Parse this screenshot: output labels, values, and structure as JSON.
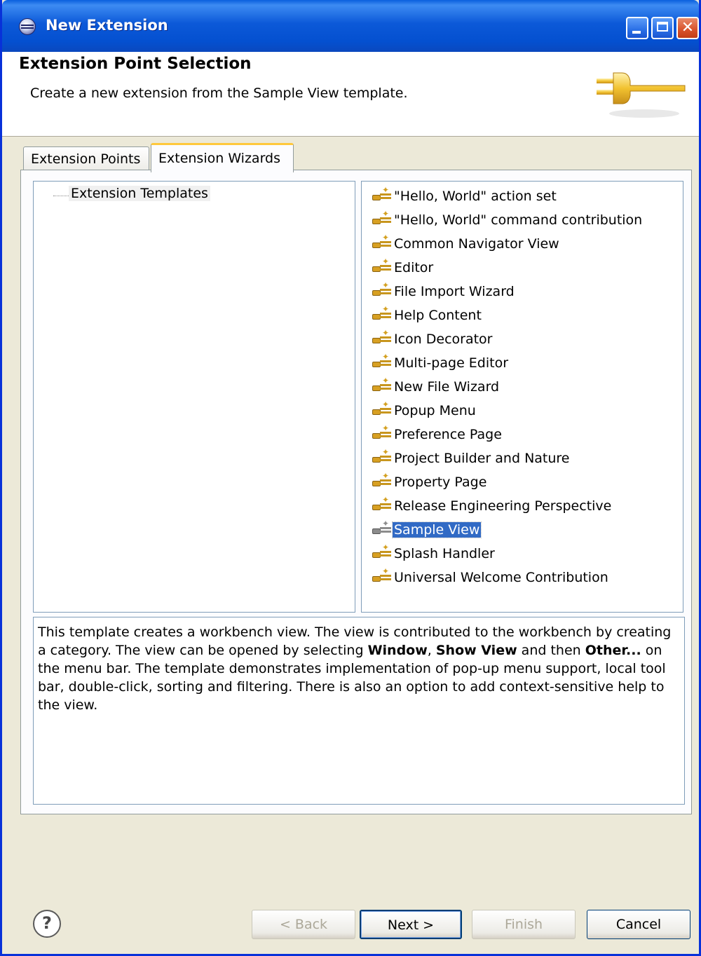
{
  "window": {
    "title": "New Extension",
    "controls": [
      "minimize",
      "maximize",
      "close"
    ]
  },
  "header": {
    "title": "Extension Point Selection",
    "description": "Create a new extension from the Sample View template.",
    "icon": "plug-icon"
  },
  "tabs": [
    {
      "label": "Extension Points",
      "active": false
    },
    {
      "label": "Extension Wizards",
      "active": true
    }
  ],
  "tree": {
    "root_label": "Extension Templates"
  },
  "templates": {
    "items": [
      "\"Hello, World\" action set",
      "\"Hello, World\" command contribution",
      "Common Navigator View",
      "Editor",
      "File Import Wizard",
      "Help Content",
      "Icon Decorator",
      "Multi-page Editor",
      "New File Wizard",
      "Popup Menu",
      "Preference Page",
      "Project Builder and Nature",
      "Property Page",
      "Release Engineering Perspective",
      "Sample View",
      "Splash Handler",
      "Universal Welcome Contribution"
    ],
    "selected": "Sample View"
  },
  "description": {
    "part1": "This template creates a workbench view. The view is contributed to the workbench by creating a category. The view can be opened by selecting ",
    "bold1": "Window",
    "sep1": ", ",
    "bold2": "Show View",
    "part2": " and then ",
    "bold3": "Other...",
    "part3": " on the menu bar. The template demonstrates implementation of pop-up menu support, local tool bar, double-click, sorting and filtering. There is also an option to add context-sensitive help to the view."
  },
  "buttons": {
    "help": "?",
    "back": "< Back",
    "next": "Next >",
    "finish": "Finish",
    "cancel": "Cancel"
  }
}
